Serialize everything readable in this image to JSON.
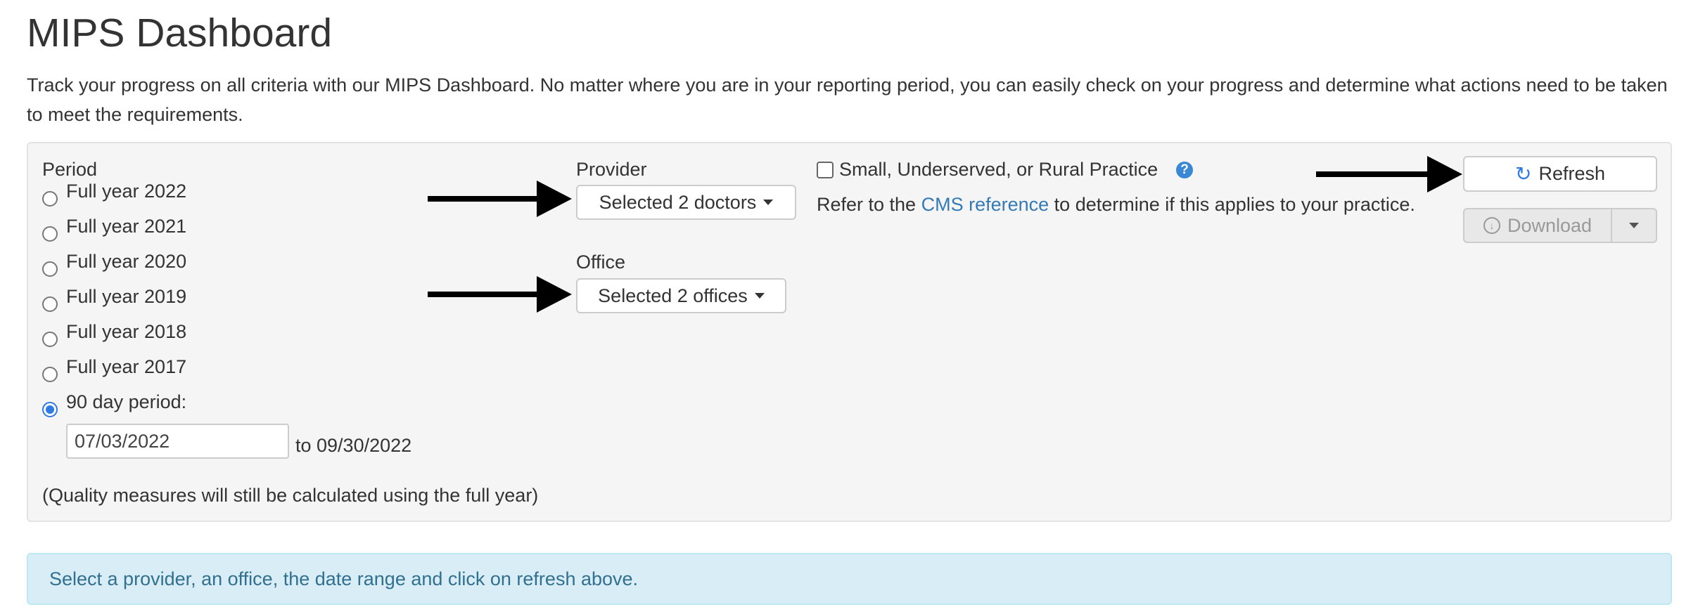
{
  "page": {
    "title": "MIPS Dashboard",
    "description": "Track your progress on all criteria with our MIPS Dashboard. No matter where you are in your reporting period, you can easily check on your progress and determine what actions need to be taken to meet the requirements."
  },
  "period": {
    "label": "Period",
    "options": [
      {
        "label": "Full year 2022",
        "selected": false
      },
      {
        "label": "Full year 2021",
        "selected": false
      },
      {
        "label": "Full year 2020",
        "selected": false
      },
      {
        "label": "Full year 2019",
        "selected": false
      },
      {
        "label": "Full year 2018",
        "selected": false
      },
      {
        "label": "Full year 2017",
        "selected": false
      },
      {
        "label": "90 day period:",
        "selected": true
      }
    ],
    "start_date": "07/03/2022",
    "end_text": "to 09/30/2022",
    "note": "(Quality measures will still be calculated using the full year)"
  },
  "provider": {
    "label": "Provider",
    "button": "Selected 2 doctors"
  },
  "office": {
    "label": "Office",
    "button": "Selected 2 offices"
  },
  "practice": {
    "checkbox_label": "Small, Underserved, or Rural Practice",
    "checked": false,
    "help_icon": "question-circle-icon",
    "refer_prefix": "Refer to the ",
    "link": "CMS reference",
    "refer_suffix": " to determine if this applies to your practice."
  },
  "actions": {
    "refresh": "Refresh",
    "download": "Download"
  },
  "alert": {
    "text": "Select a provider, an office, the date range and click on refresh above."
  },
  "colors": {
    "link": "#337ab7",
    "alert_bg": "#d9edf7",
    "alert_text": "#31708f",
    "radio_selected": "#2f7ae5"
  }
}
